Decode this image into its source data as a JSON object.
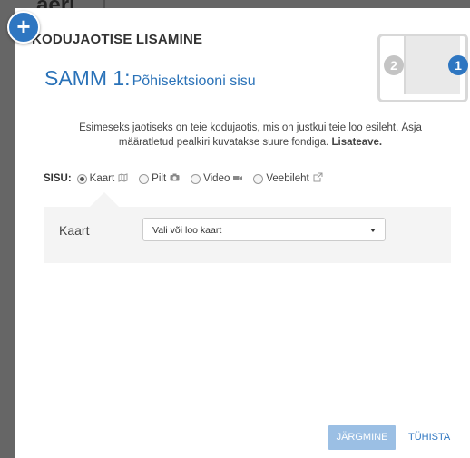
{
  "background": {
    "logo_fragment": "aeri"
  },
  "dialog": {
    "title": "KODUJAOTISE LISAMINE",
    "step": {
      "number": "SAMM 1:",
      "subtitle": "Põhisektsiooni sisu"
    },
    "steps_widget": {
      "step_2": "2",
      "step_1": "1"
    },
    "description": "Esimeseks jaotiseks on teie kodujaotis, mis on justkui teie loo esileht. Äsja määratletud pealkiri kuvatakse suure fondiga.",
    "description_link": "Lisateave.",
    "content": {
      "label": "SISU:",
      "options": [
        {
          "label": "Kaart",
          "checked": true,
          "icon": "map-icon"
        },
        {
          "label": "Pilt",
          "checked": false,
          "icon": "camera-icon"
        },
        {
          "label": "Video",
          "checked": false,
          "icon": "video-icon"
        },
        {
          "label": "Veebileht",
          "checked": false,
          "icon": "external-link-icon"
        }
      ]
    },
    "panel": {
      "label": "Kaart",
      "select_value": "Vali või loo kaart"
    },
    "buttons": {
      "next": "JÄRGMINE",
      "cancel": "TÜHISTA"
    }
  },
  "colors": {
    "accent": "#2e76c1",
    "next_button": "#9bbfe4",
    "panel_bg": "#f4f4f4"
  }
}
